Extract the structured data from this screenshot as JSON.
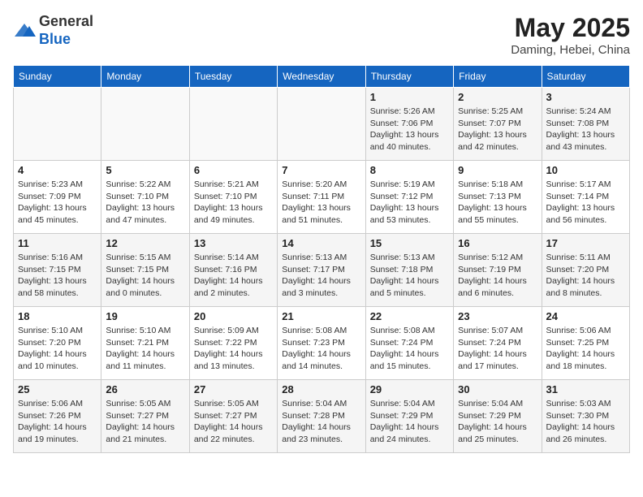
{
  "logo": {
    "general": "General",
    "blue": "Blue"
  },
  "title": "May 2025",
  "location": "Daming, Hebei, China",
  "headers": [
    "Sunday",
    "Monday",
    "Tuesday",
    "Wednesday",
    "Thursday",
    "Friday",
    "Saturday"
  ],
  "weeks": [
    [
      {
        "day": "",
        "info": ""
      },
      {
        "day": "",
        "info": ""
      },
      {
        "day": "",
        "info": ""
      },
      {
        "day": "",
        "info": ""
      },
      {
        "day": "1",
        "info": "Sunrise: 5:26 AM\nSunset: 7:06 PM\nDaylight: 13 hours\nand 40 minutes."
      },
      {
        "day": "2",
        "info": "Sunrise: 5:25 AM\nSunset: 7:07 PM\nDaylight: 13 hours\nand 42 minutes."
      },
      {
        "day": "3",
        "info": "Sunrise: 5:24 AM\nSunset: 7:08 PM\nDaylight: 13 hours\nand 43 minutes."
      }
    ],
    [
      {
        "day": "4",
        "info": "Sunrise: 5:23 AM\nSunset: 7:09 PM\nDaylight: 13 hours\nand 45 minutes."
      },
      {
        "day": "5",
        "info": "Sunrise: 5:22 AM\nSunset: 7:10 PM\nDaylight: 13 hours\nand 47 minutes."
      },
      {
        "day": "6",
        "info": "Sunrise: 5:21 AM\nSunset: 7:10 PM\nDaylight: 13 hours\nand 49 minutes."
      },
      {
        "day": "7",
        "info": "Sunrise: 5:20 AM\nSunset: 7:11 PM\nDaylight: 13 hours\nand 51 minutes."
      },
      {
        "day": "8",
        "info": "Sunrise: 5:19 AM\nSunset: 7:12 PM\nDaylight: 13 hours\nand 53 minutes."
      },
      {
        "day": "9",
        "info": "Sunrise: 5:18 AM\nSunset: 7:13 PM\nDaylight: 13 hours\nand 55 minutes."
      },
      {
        "day": "10",
        "info": "Sunrise: 5:17 AM\nSunset: 7:14 PM\nDaylight: 13 hours\nand 56 minutes."
      }
    ],
    [
      {
        "day": "11",
        "info": "Sunrise: 5:16 AM\nSunset: 7:15 PM\nDaylight: 13 hours\nand 58 minutes."
      },
      {
        "day": "12",
        "info": "Sunrise: 5:15 AM\nSunset: 7:15 PM\nDaylight: 14 hours\nand 0 minutes."
      },
      {
        "day": "13",
        "info": "Sunrise: 5:14 AM\nSunset: 7:16 PM\nDaylight: 14 hours\nand 2 minutes."
      },
      {
        "day": "14",
        "info": "Sunrise: 5:13 AM\nSunset: 7:17 PM\nDaylight: 14 hours\nand 3 minutes."
      },
      {
        "day": "15",
        "info": "Sunrise: 5:13 AM\nSunset: 7:18 PM\nDaylight: 14 hours\nand 5 minutes."
      },
      {
        "day": "16",
        "info": "Sunrise: 5:12 AM\nSunset: 7:19 PM\nDaylight: 14 hours\nand 6 minutes."
      },
      {
        "day": "17",
        "info": "Sunrise: 5:11 AM\nSunset: 7:20 PM\nDaylight: 14 hours\nand 8 minutes."
      }
    ],
    [
      {
        "day": "18",
        "info": "Sunrise: 5:10 AM\nSunset: 7:20 PM\nDaylight: 14 hours\nand 10 minutes."
      },
      {
        "day": "19",
        "info": "Sunrise: 5:10 AM\nSunset: 7:21 PM\nDaylight: 14 hours\nand 11 minutes."
      },
      {
        "day": "20",
        "info": "Sunrise: 5:09 AM\nSunset: 7:22 PM\nDaylight: 14 hours\nand 13 minutes."
      },
      {
        "day": "21",
        "info": "Sunrise: 5:08 AM\nSunset: 7:23 PM\nDaylight: 14 hours\nand 14 minutes."
      },
      {
        "day": "22",
        "info": "Sunrise: 5:08 AM\nSunset: 7:24 PM\nDaylight: 14 hours\nand 15 minutes."
      },
      {
        "day": "23",
        "info": "Sunrise: 5:07 AM\nSunset: 7:24 PM\nDaylight: 14 hours\nand 17 minutes."
      },
      {
        "day": "24",
        "info": "Sunrise: 5:06 AM\nSunset: 7:25 PM\nDaylight: 14 hours\nand 18 minutes."
      }
    ],
    [
      {
        "day": "25",
        "info": "Sunrise: 5:06 AM\nSunset: 7:26 PM\nDaylight: 14 hours\nand 19 minutes."
      },
      {
        "day": "26",
        "info": "Sunrise: 5:05 AM\nSunset: 7:27 PM\nDaylight: 14 hours\nand 21 minutes."
      },
      {
        "day": "27",
        "info": "Sunrise: 5:05 AM\nSunset: 7:27 PM\nDaylight: 14 hours\nand 22 minutes."
      },
      {
        "day": "28",
        "info": "Sunrise: 5:04 AM\nSunset: 7:28 PM\nDaylight: 14 hours\nand 23 minutes."
      },
      {
        "day": "29",
        "info": "Sunrise: 5:04 AM\nSunset: 7:29 PM\nDaylight: 14 hours\nand 24 minutes."
      },
      {
        "day": "30",
        "info": "Sunrise: 5:04 AM\nSunset: 7:29 PM\nDaylight: 14 hours\nand 25 minutes."
      },
      {
        "day": "31",
        "info": "Sunrise: 5:03 AM\nSunset: 7:30 PM\nDaylight: 14 hours\nand 26 minutes."
      }
    ]
  ]
}
